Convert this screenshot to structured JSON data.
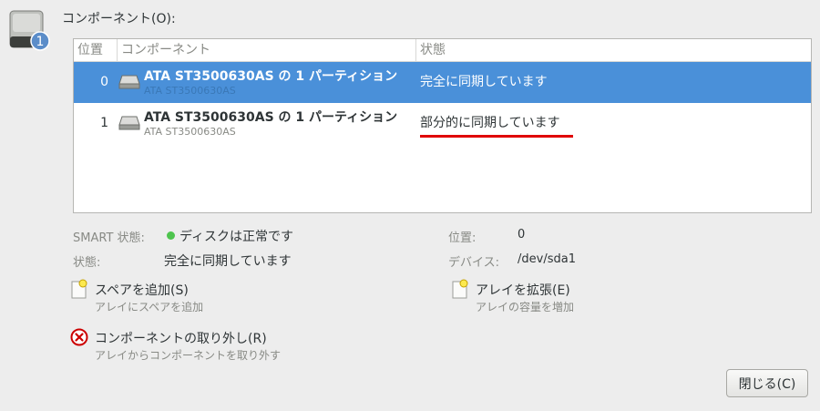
{
  "header": {
    "title": "コンポーネント(O):",
    "badge": "1"
  },
  "table": {
    "columns": [
      "位置",
      "コンポーネント",
      "状態"
    ],
    "rows": [
      {
        "position": "0",
        "name": "ATA ST3500630AS の 1 パーティション",
        "sub": "ATA ST3500630AS",
        "state": "完全に同期しています",
        "selected": true
      },
      {
        "position": "1",
        "name": "ATA ST3500630AS の 1 パーティション",
        "sub": "ATA ST3500630AS",
        "state": "部分的に同期しています",
        "selected": false
      }
    ]
  },
  "details": {
    "smart_label": "SMART 状態:",
    "smart_value": "ディスクは正常です",
    "state_label": "状態:",
    "state_value": "完全に同期しています",
    "position_label": "位置:",
    "position_value": "0",
    "device_label": "デバイス:",
    "device_value": "/dev/sda1"
  },
  "actions": {
    "add_spare_title": "スペアを追加(S)",
    "add_spare_sub": "アレイにスペアを追加",
    "expand_title": "アレイを拡張(E)",
    "expand_sub": "アレイの容量を増加",
    "remove_title": "コンポーネントの取り外し(R)",
    "remove_sub": "アレイからコンポーネントを取り外す"
  },
  "buttons": {
    "close_label": "閉じる(C)"
  },
  "icons": {
    "header": "raid-disk-icon",
    "row": "harddisk-icon",
    "smart_status": "green-dot-icon",
    "add_spare": "new-document-icon",
    "expand": "new-document-icon",
    "remove": "remove-circle-icon"
  },
  "colors": {
    "selection": "#4a90d9",
    "annotation_underline": "#e00000",
    "smart_ok": "#4ec44e"
  }
}
